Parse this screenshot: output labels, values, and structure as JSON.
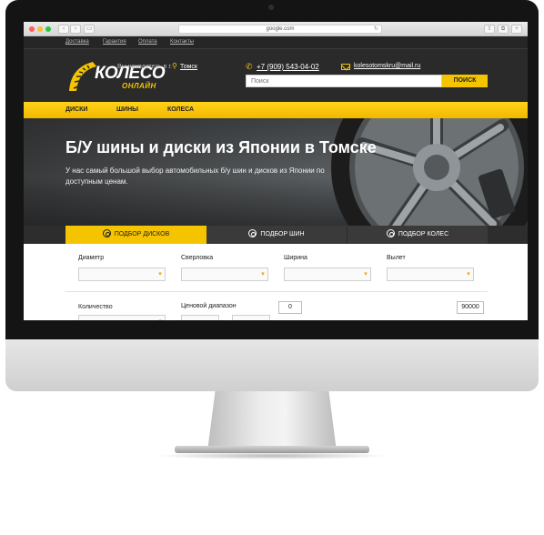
{
  "browser": {
    "url": "google.com"
  },
  "top_links": [
    "Доставка",
    "Гарантия",
    "Оплата",
    "Контакты"
  ],
  "header": {
    "logo_text": "КОЛЕСО",
    "logo_subtext": "ОНЛАЙН",
    "location_prefix": "Вы находитесь в г.",
    "location_city": "Томск",
    "phone": "+7 (909) 543-04-02",
    "email": "kolesotomskru@mail.ru",
    "search_placeholder": "Поиск",
    "search_button": "ПОИСК"
  },
  "main_nav": [
    "ДИСКИ",
    "ШИНЫ",
    "КОЛЕСА"
  ],
  "hero": {
    "title": "Б/У шины и диски из Японии в Томске",
    "text": "У нас самый большой выбор автомобильных б/у шин и дисков из Японии по доступным ценам."
  },
  "tabs": [
    {
      "label": "ПОДБОР ДИСКОВ",
      "active": true
    },
    {
      "label": "ПОДБОР ШИН",
      "active": false
    },
    {
      "label": "ПОДБОР КОЛЕС",
      "active": false
    }
  ],
  "filters": {
    "row1": [
      "Диаметр",
      "Сверловка",
      "Ширина",
      "Вылет"
    ],
    "row2": {
      "quantity_label": "Количество",
      "price_label": "Ценовой диапазон",
      "price_min": "0",
      "price_max": "90000"
    }
  },
  "colors": {
    "accent": "#f5c400",
    "dark": "#2a2a2a"
  }
}
